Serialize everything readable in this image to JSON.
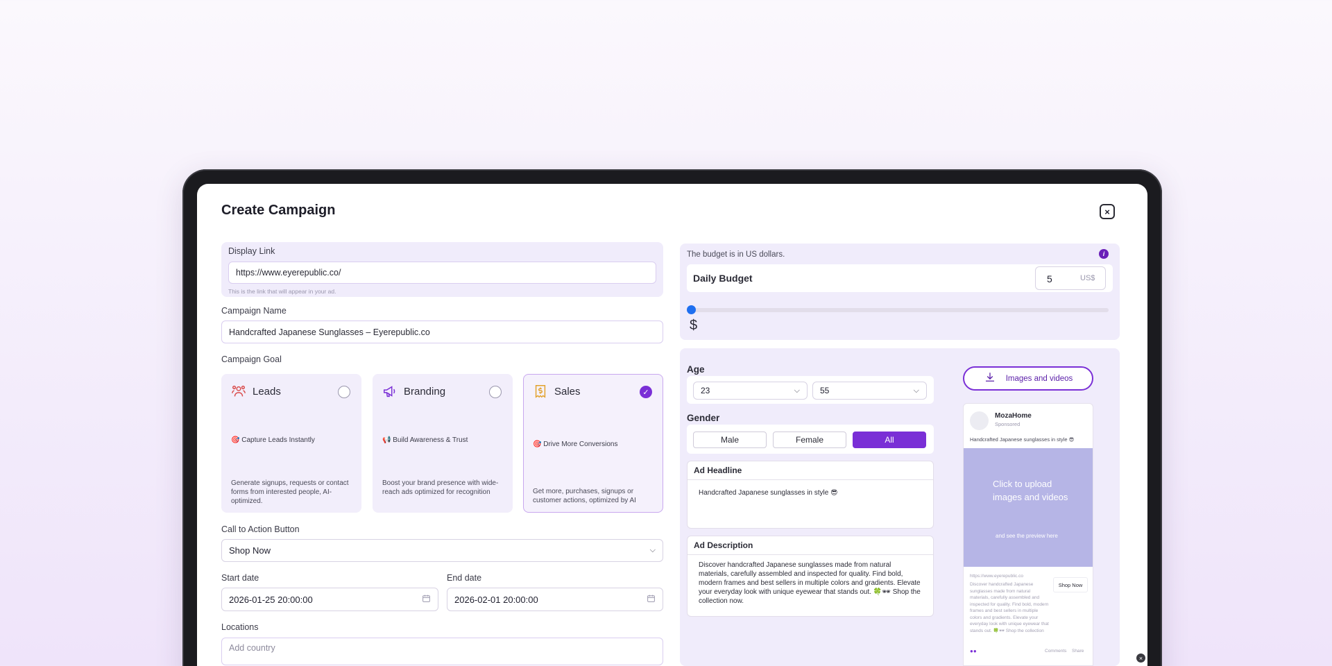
{
  "modal": {
    "title": "Create Campaign",
    "close_glyph": "×"
  },
  "display_link": {
    "label": "Display Link",
    "value": "https://www.eyerepublic.co/",
    "hint": "This is the link that will appear in your ad."
  },
  "campaign_name": {
    "label": "Campaign Name",
    "value": "Handcrafted Japanese Sunglasses – Eyerepublic.co"
  },
  "campaign_goal": {
    "label": "Campaign Goal",
    "options": [
      {
        "title": "Leads",
        "icon": "users-icon",
        "subtitle": "🎯 Capture Leads Instantly",
        "description": "Generate signups, requests or contact forms from interested people, AI-optimized.",
        "selected": false
      },
      {
        "title": "Branding",
        "icon": "megaphone-icon",
        "subtitle": "📢 Build Awareness & Trust",
        "description": "Boost your brand presence with wide-reach ads optimized for recognition",
        "selected": false
      },
      {
        "title": "Sales",
        "icon": "receipt-dollar-icon",
        "subtitle": "🎯 Drive More Conversions",
        "description": "Get more, purchases, signups or customer actions, optimized by AI",
        "selected": true
      }
    ]
  },
  "cta": {
    "label": "Call to Action Button",
    "value": "Shop Now"
  },
  "dates": {
    "start_label": "Start date",
    "start_value": "2026-01-25 20:00:00",
    "end_label": "End date",
    "end_value": "2026-02-01 20:00:00"
  },
  "locations": {
    "label": "Locations",
    "placeholder": "Add country"
  },
  "budget": {
    "note": "The budget is in US dollars.",
    "label": "Daily Budget",
    "value": "5",
    "currency": "US$",
    "slider_fraction": 0.0,
    "dollar_glyph": "$"
  },
  "age": {
    "label": "Age",
    "min": "23",
    "max": "55"
  },
  "gender": {
    "label": "Gender",
    "options": [
      "Male",
      "Female",
      "All"
    ],
    "selected": "All"
  },
  "headline": {
    "label": "Ad Headline",
    "value": "Handcrafted Japanese sunglasses in style 😎"
  },
  "description": {
    "label": "Ad Description",
    "value": "Discover handcrafted Japanese sunglasses made from natural materials, carefully assembled and inspected for quality. Find bold, modern frames and best sellers in multiple colors and gradients. Elevate your everyday look with unique eyewear that stands out. 🍀🕶 Shop the collection now."
  },
  "media": {
    "button_label": "Images and videos"
  },
  "preview": {
    "page_name": "MozaHome",
    "sponsored": "Sponsored",
    "caption": "Handcrafted Japanese sunglasses in style 😎",
    "upload_text": "Click to upload images and videos",
    "upload_sub": "and see the preview here",
    "link": "https://www.eyerepublic.co",
    "body": "Discover handcrafted Japanese sunglasses made from natural materials, carefully assembled and inspected for quality. Find bold, modern frames and best sellers in multiple colors and gradients. Elevate your everyday look with unique eyewear that stands out. 🍀🕶 Shop the collection now.",
    "shop_button": "Shop Now",
    "footer_comments": "Comments",
    "footer_share": "Share"
  },
  "colors": {
    "accent": "#7a2fd6",
    "panel": "#f0ecfb",
    "upload": "#b6b5e6"
  }
}
